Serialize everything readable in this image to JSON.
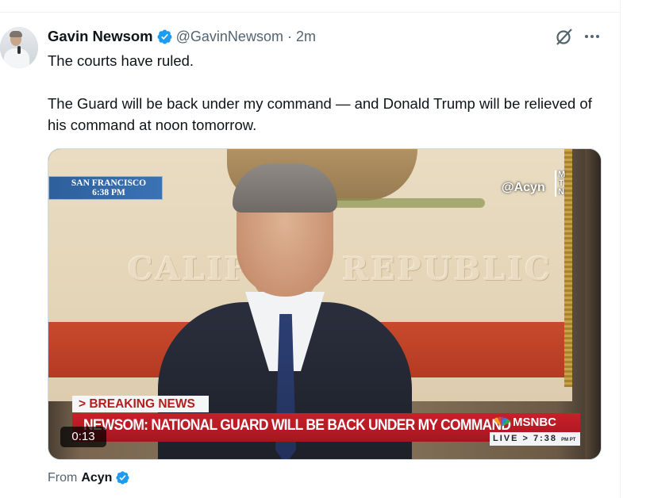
{
  "tweet": {
    "author_name": "Gavin Newsom",
    "author_handle": "@GavinNewsom",
    "separator": "·",
    "time": "2m",
    "text_line1": "The courts have ruled.",
    "text_line2": "The Guard will be back under my command — and Donald Trump will be relieved of his command at noon tomorrow."
  },
  "video": {
    "location": "SAN FRANCISCO",
    "location_time": "6:38 PM",
    "watermark": "@Acyn",
    "watermark_mtn": [
      "M",
      "T",
      "N"
    ],
    "breaking_label": "> BREAKING NEWS",
    "headline": "NEWSOM: NATIONAL GUARD WILL BE BACK UNDER MY COMMAND",
    "network": "MSNBC",
    "live_label": "LIVE > 7:38",
    "live_suffix": "PM PT",
    "flag_words": [
      "CALIFOR",
      "REPUBLIC"
    ],
    "duration": "0:13"
  },
  "attribution": {
    "from_label": "From",
    "author": "Acyn"
  },
  "icons": {
    "verified": "verified-badge-icon",
    "grok": "grok-icon",
    "more": "more-options-icon"
  },
  "colors": {
    "verified_blue": "#1d9bf0",
    "text_primary": "#0f1419",
    "text_secondary": "#536471",
    "msnbc_red": "#c8202a"
  }
}
